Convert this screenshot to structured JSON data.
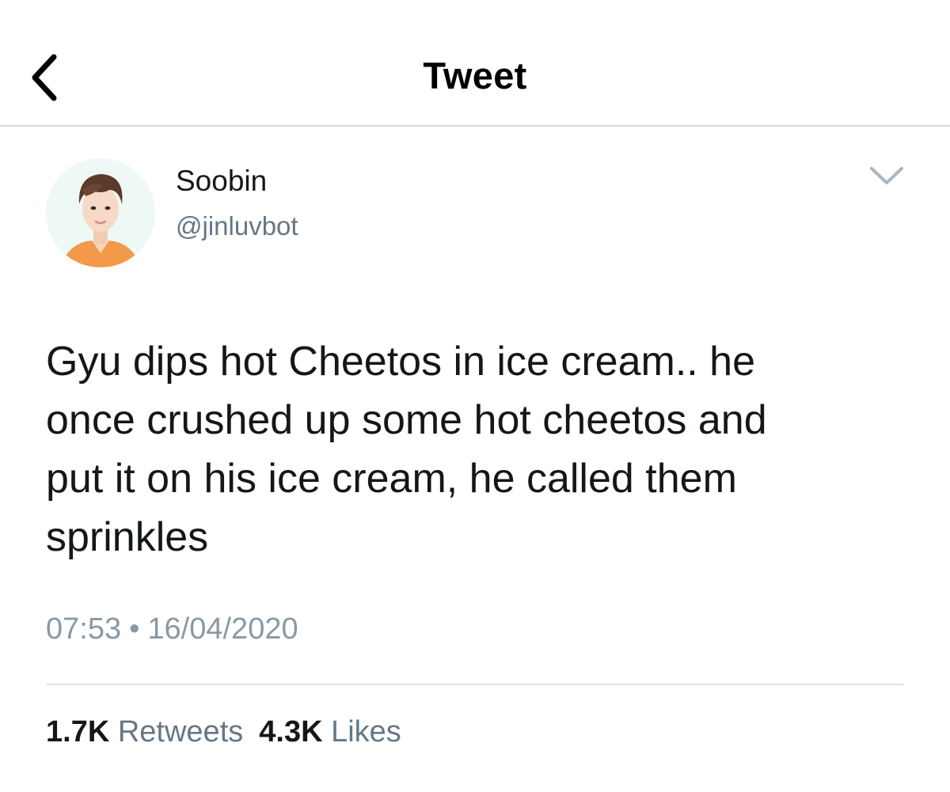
{
  "header": {
    "title": "Tweet",
    "back_icon": "chevron-left-icon"
  },
  "author": {
    "display_name": "Soobin",
    "handle": "@jinluvbot",
    "more_icon": "chevron-down-icon"
  },
  "tweet": {
    "lines": [
      "Gyu dips hot Cheetos in ice cream.. he",
      "once crushed up some hot cheetos and",
      "put it on his ice cream, he called them",
      "sprinkles"
    ],
    "time": "07:53",
    "separator": "•",
    "date": "16/04/2020"
  },
  "stats": {
    "retweets_count": "1.7K",
    "retweets_label": "Retweets",
    "likes_count": "4.3K",
    "likes_label": "Likes"
  },
  "colors": {
    "text": "#14171a",
    "secondary": "#657786",
    "timestamp": "#8899a6",
    "divider": "#dfe3e6"
  }
}
